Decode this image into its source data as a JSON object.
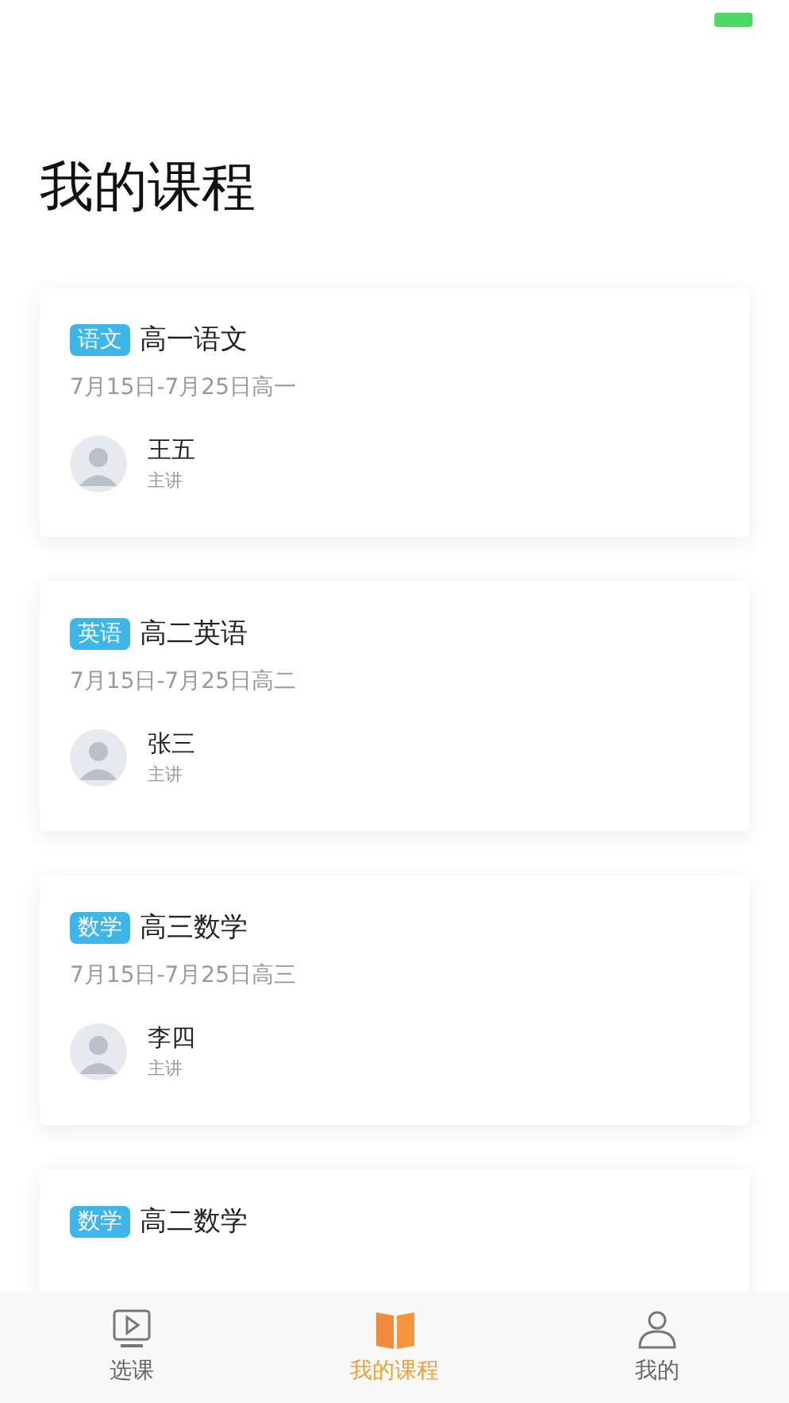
{
  "page_title": "我的课程",
  "courses": [
    {
      "tag": "语文",
      "title": "高一语文",
      "dates": "7月15日-7月25日高一",
      "teacher": "王五",
      "role": "主讲"
    },
    {
      "tag": "英语",
      "title": "高二英语",
      "dates": "7月15日-7月25日高二",
      "teacher": "张三",
      "role": "主讲"
    },
    {
      "tag": "数学",
      "title": "高三数学",
      "dates": "7月15日-7月25日高三",
      "teacher": "李四",
      "role": "主讲"
    },
    {
      "tag": "数学",
      "title": "高二数学"
    }
  ],
  "tab_bar": [
    {
      "label": "选课",
      "kind": "video",
      "selected": false
    },
    {
      "label": "我的课程",
      "kind": "book",
      "selected": true
    },
    {
      "label": "我的",
      "kind": "person",
      "selected": false
    }
  ]
}
